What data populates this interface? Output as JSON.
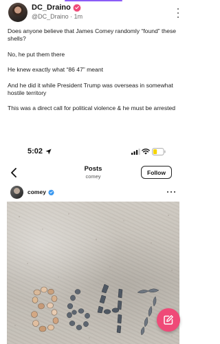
{
  "post": {
    "author": {
      "display_name": "DC_Draino",
      "handle": "@DC_Draino",
      "age": "1m",
      "verified": true
    },
    "paragraphs": [
      "Does anyone believe that James Comey randomly “found” these shells?",
      "No, he put them there",
      "He knew exactly what “86 47” meant",
      "And he did it while President Trump was overseas in somewhat hostile territory",
      "This was a direct call for political violence & he must be arrested"
    ]
  },
  "embedded_screenshot": {
    "status_bar": {
      "time": "5:02",
      "icons": [
        "location-arrow-icon",
        "signal-icon",
        "wifi-icon",
        "battery-icon"
      ],
      "battery_color": "#f5d400"
    },
    "nav": {
      "title": "Posts",
      "subtitle": "comey",
      "follow_label": "Follow"
    },
    "post_header": {
      "username": "comey",
      "verified": true
    },
    "photo_text": "8647"
  },
  "colors": {
    "accent": "#8b5cf6",
    "verified_badge": "#ef4a78",
    "fab": "#ef4a78",
    "ig_verified": "#3897f0"
  }
}
